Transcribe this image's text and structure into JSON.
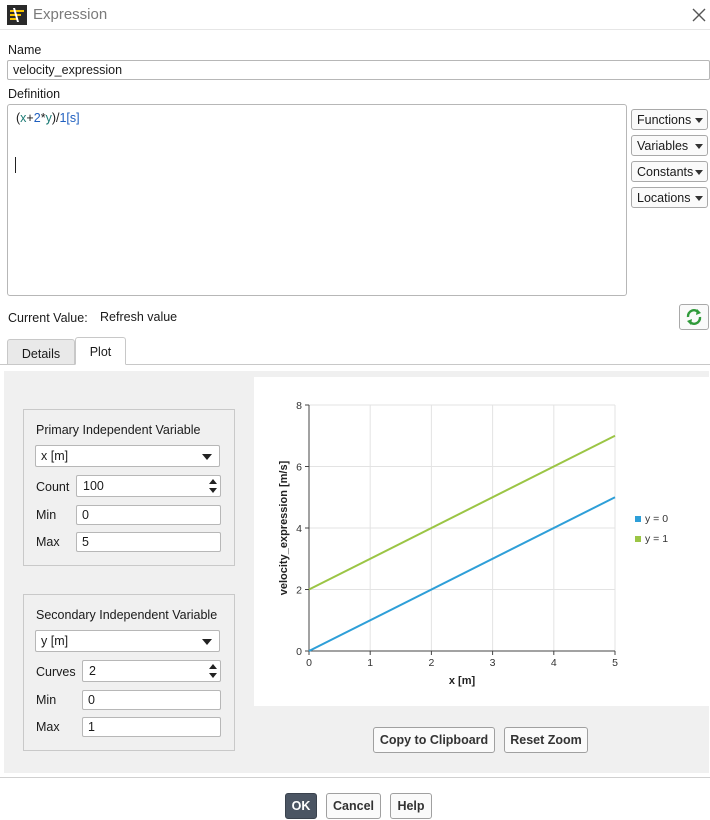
{
  "window": {
    "title": "Expression"
  },
  "name": {
    "label": "Name",
    "value": "velocity_expression"
  },
  "definition": {
    "label": "Definition",
    "tokens": {
      "open": "(",
      "x": "x",
      "plus": "+",
      "two": "2",
      "mul": "*",
      "y": "y",
      "close": ")",
      "div": "/",
      "one": "1",
      "unit": "[s]"
    }
  },
  "menus": {
    "functions": "Functions",
    "variables": "Variables",
    "constants": "Constants",
    "locations": "Locations"
  },
  "current_value": {
    "label": "Current Value:",
    "value": "Refresh value"
  },
  "tabs": {
    "details": "Details",
    "plot": "Plot",
    "active": "Plot"
  },
  "primary": {
    "title": "Primary Independent Variable",
    "variable": "x [m]",
    "count_label": "Count",
    "count": "100",
    "min_label": "Min",
    "min": "0",
    "max_label": "Max",
    "max": "5"
  },
  "secondary": {
    "title": "Secondary Independent Variable",
    "variable": "y [m]",
    "curves_label": "Curves",
    "curves": "2",
    "min_label": "Min",
    "min": "0",
    "max_label": "Max",
    "max": "1"
  },
  "buttons": {
    "copy": "Copy to Clipboard",
    "reset_zoom": "Reset Zoom",
    "ok": "OK",
    "cancel": "Cancel",
    "help": "Help"
  },
  "chart_data": {
    "type": "line",
    "xlabel": "x [m]",
    "ylabel": "velocity_expression [m/s]",
    "xlim": [
      0,
      5
    ],
    "ylim": [
      0,
      8
    ],
    "xticks": [
      0,
      1,
      2,
      3,
      4,
      5
    ],
    "yticks": [
      0,
      2,
      4,
      6,
      8
    ],
    "grid": true,
    "legend_position": "right",
    "series": [
      {
        "name": "y = 0",
        "color": "#2e9fd8",
        "x": [
          0,
          5
        ],
        "y": [
          0,
          5
        ]
      },
      {
        "name": "y = 1",
        "color": "#9bc545",
        "x": [
          0,
          5
        ],
        "y": [
          2,
          7
        ]
      }
    ]
  }
}
